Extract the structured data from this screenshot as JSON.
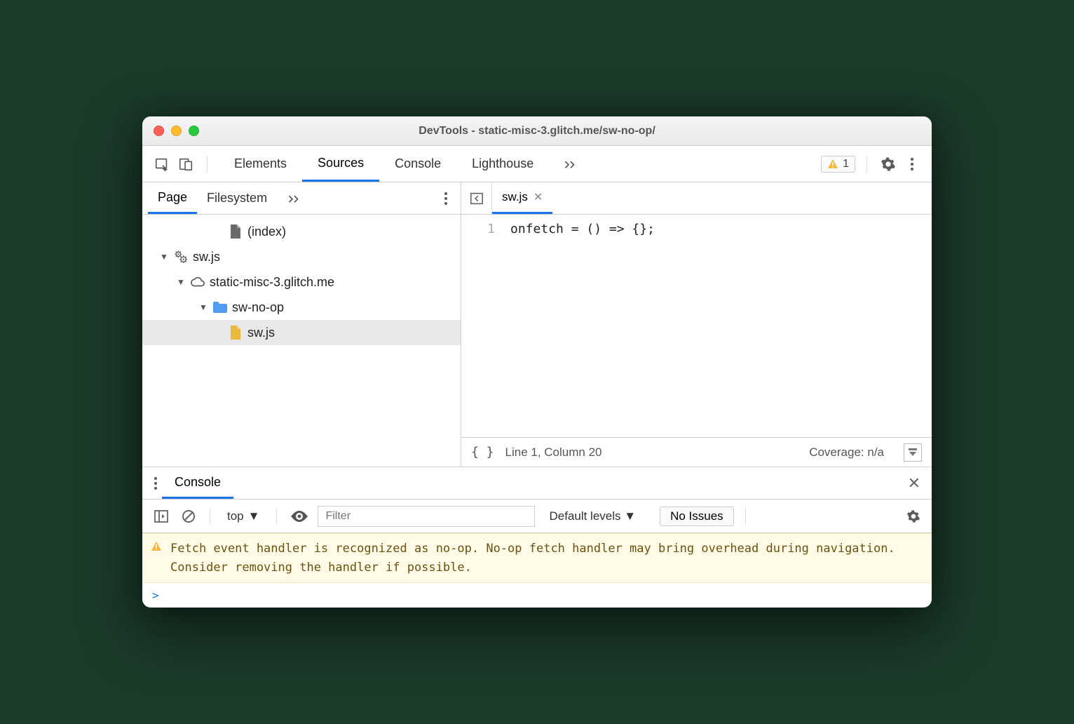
{
  "window": {
    "title": "DevTools - static-misc-3.glitch.me/sw-no-op/"
  },
  "toolbar": {
    "tabs": [
      "Elements",
      "Sources",
      "Console",
      "Lighthouse"
    ],
    "active": "Sources",
    "warn_count": "1"
  },
  "sidebar": {
    "tabs": [
      "Page",
      "Filesystem"
    ],
    "active": "Page",
    "nodes": {
      "index_label": "(index)",
      "sw_worker": "sw.js",
      "origin": "static-misc-3.glitch.me",
      "folder": "sw-no-op",
      "file": "sw.js"
    }
  },
  "editor": {
    "tab": "sw.js",
    "lineno": "1",
    "code": "onfetch = () => {};",
    "status_pos": "Line 1, Column 20",
    "coverage": "Coverage: n/a"
  },
  "drawer": {
    "tab": "Console",
    "scope": "top",
    "filter_placeholder": "Filter",
    "level": "Default levels",
    "issues": "No Issues"
  },
  "console": {
    "warning": "Fetch event handler is recognized as no-op. No-op fetch handler may bring overhead during navigation. Consider removing the handler if possible."
  }
}
